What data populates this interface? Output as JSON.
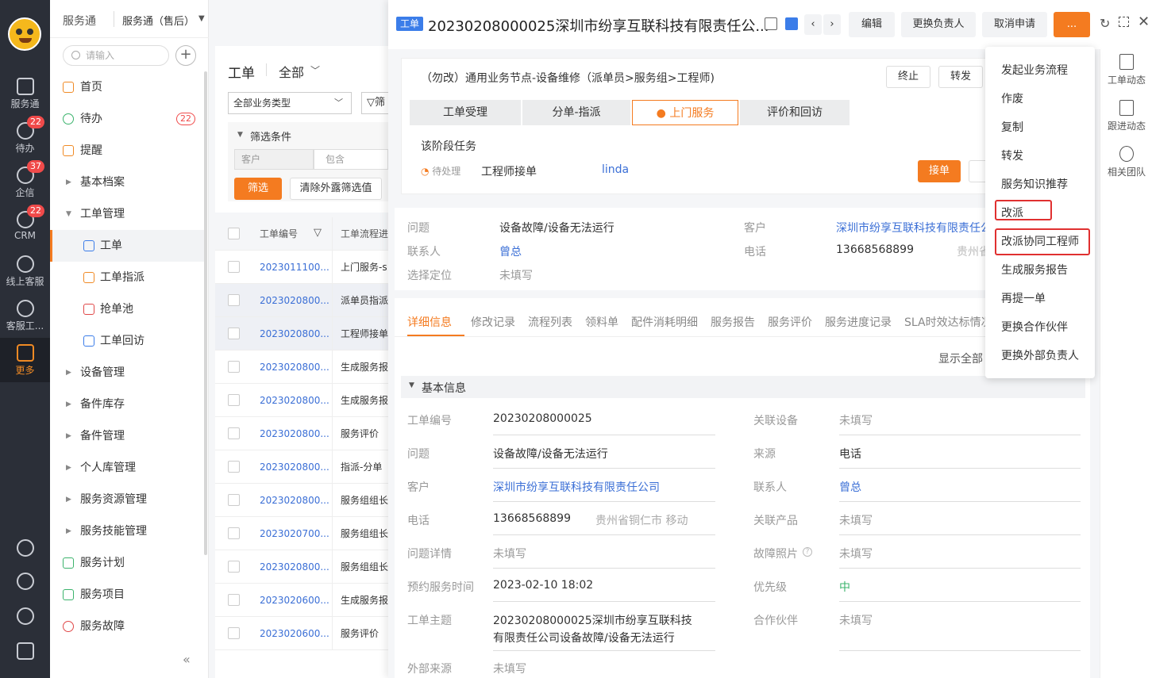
{
  "rail": {
    "items": [
      {
        "label": "服务通"
      },
      {
        "label": "待办",
        "badge": "22"
      },
      {
        "label": "企信",
        "badge": "37"
      },
      {
        "label": "CRM",
        "badge": "22"
      },
      {
        "label": "线上客服"
      },
      {
        "label": "客服工..."
      },
      {
        "label": "更多"
      }
    ]
  },
  "nav": {
    "app": "服务通",
    "app_switch": "服务通（售后）",
    "search_placeholder": "请输入",
    "items": [
      {
        "label": "首页"
      },
      {
        "label": "待办",
        "badge": "22"
      },
      {
        "label": "提醒"
      },
      {
        "label": "基本档案"
      },
      {
        "label": "工单管理"
      },
      {
        "label": "工单"
      },
      {
        "label": "工单指派"
      },
      {
        "label": "抢单池"
      },
      {
        "label": "工单回访"
      },
      {
        "label": "设备管理"
      },
      {
        "label": "备件库存"
      },
      {
        "label": "备件管理"
      },
      {
        "label": "个人库管理"
      },
      {
        "label": "服务资源管理"
      },
      {
        "label": "服务技能管理"
      },
      {
        "label": "服务计划"
      },
      {
        "label": "服务项目"
      },
      {
        "label": "服务故障"
      }
    ]
  },
  "list": {
    "title": "工单",
    "scope": "全部",
    "type_select": "全部业务类型",
    "filter_label": "筛",
    "conditions_label": "筛选条件",
    "cond_field": "客户",
    "cond_op": "包含",
    "filter_btn": "筛选",
    "clear_btn": "清除外露筛选值",
    "col_no": "工单编号",
    "col_flow": "工单流程进",
    "rows": [
      {
        "no": "2023011100...",
        "flow": "上门服务-s"
      },
      {
        "no": "2023020800...",
        "flow": "派单员指派"
      },
      {
        "no": "2023020800...",
        "flow": "工程师接单"
      },
      {
        "no": "2023020800...",
        "flow": "生成服务报"
      },
      {
        "no": "2023020800...",
        "flow": "生成服务报"
      },
      {
        "no": "2023020800...",
        "flow": "服务评价"
      },
      {
        "no": "2023020800...",
        "flow": "指派-分单"
      },
      {
        "no": "2023020800...",
        "flow": "服务组组长"
      },
      {
        "no": "2023020700...",
        "flow": "服务组组长"
      },
      {
        "no": "2023020800...",
        "flow": "服务组组长"
      },
      {
        "no": "2023020600...",
        "flow": "生成服务报"
      },
      {
        "no": "2023020600...",
        "flow": "服务评价"
      }
    ]
  },
  "detail": {
    "tag": "工单",
    "title": "20230208000025深圳市纷享互联科技有限责任公...",
    "btn_edit": "编辑",
    "btn_owner": "更换负责人",
    "btn_cancel": "取消申请",
    "btn_more": "...",
    "flow_name": "（勿改）通用业务节点-设备维修（派单员>服务组>工程师)",
    "btn_stop": "终止",
    "btn_forward": "转发",
    "stages": [
      "工单受理",
      "分单-指派",
      "上门服务",
      "评价和回访"
    ],
    "stage_task_label": "该阶段任务",
    "task_status": "待处理",
    "task_name": "工程师接单",
    "task_user": "linda",
    "btn_accept": "接单",
    "summary": {
      "problem_label": "问题",
      "problem": "设备故障/设备无法运行",
      "contact_label": "联系人",
      "contact": "曾总",
      "location_label": "选择定位",
      "location": "未填写",
      "customer_label": "客户",
      "customer": "深圳市纷享互联科技有限责任公",
      "phone_label": "电话",
      "phone": "13668568899",
      "phone_region": "贵州省"
    },
    "tabs": [
      "详细信息",
      "修改记录",
      "流程列表",
      "领料单",
      "配件消耗明细",
      "服务报告",
      "服务评价",
      "服务进度记录",
      "SLA时效达标情况"
    ],
    "show_all": "显示全部",
    "section": "基本信息",
    "fields_left": [
      {
        "label": "工单编号",
        "value": "20230208000025"
      },
      {
        "label": "问题",
        "value": "设备故障/设备无法运行"
      },
      {
        "label": "客户",
        "value": "深圳市纷享互联科技有限责任公司"
      },
      {
        "label": "电话",
        "value": "13668568899",
        "extra": "贵州省铜仁市 移动"
      },
      {
        "label": "问题详情",
        "value": "未填写"
      },
      {
        "label": "预约服务时间",
        "value": "2023-02-10 18:02"
      },
      {
        "label": "工单主题",
        "value": "20230208000025深圳市纷享互联科技",
        "value2": "有限责任公司设备故障/设备无法运行"
      },
      {
        "label": "外部来源",
        "value": "未填写"
      }
    ],
    "fields_right": [
      {
        "label": "关联设备",
        "value": "未填写"
      },
      {
        "label": "来源",
        "value": "电话"
      },
      {
        "label": "联系人",
        "value": "曾总"
      },
      {
        "label": "关联产品",
        "value": "未填写"
      },
      {
        "label": "故障照片",
        "value": "未填写"
      },
      {
        "label": "优先级",
        "value": "中"
      },
      {
        "label": "合作伙伴",
        "value": "未填写"
      }
    ]
  },
  "menu": {
    "items": [
      "发起业务流程",
      "作废",
      "复制",
      "转发",
      "服务知识推荐",
      "改派",
      "改派协同工程师",
      "生成服务报告",
      "再提一单",
      "更换合作伙伴",
      "更换外部负责人"
    ]
  },
  "rightbar": {
    "items": [
      "工单动态",
      "跟进动态",
      "相关团队"
    ]
  },
  "colors": {
    "accent": "#f47b20",
    "link": "#3b6fd6",
    "highlight": "#e03030",
    "rail": "#2b2f38"
  }
}
